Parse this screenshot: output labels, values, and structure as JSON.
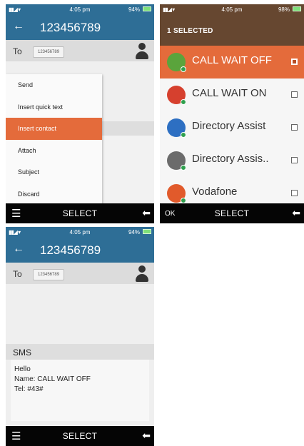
{
  "colors": {
    "title_bar": "#2e6e96",
    "selected_orange": "#e46b3b",
    "selection_header": "#664730",
    "softkey_bar": "#050505",
    "battery_green": "#7ee07a"
  },
  "screen1": {
    "status": {
      "time": "4:05 pm",
      "battery": "94%"
    },
    "title": {
      "back_icon": "arrow-left-icon",
      "number": "123456789"
    },
    "to_row": {
      "label": "To",
      "chip": "123456789",
      "icon": "person-icon"
    },
    "menu": {
      "items": [
        {
          "label": "Send",
          "selected": false
        },
        {
          "label": "Insert quick text",
          "selected": false
        },
        {
          "label": "Insert contact",
          "selected": true
        },
        {
          "label": "Attach",
          "selected": false
        },
        {
          "label": "Subject",
          "selected": false
        },
        {
          "label": "Discard",
          "selected": false
        }
      ]
    },
    "softkeys": {
      "left_icon": "menu-icon",
      "center": "SELECT",
      "right_icon": "back-arrow-icon"
    }
  },
  "screen2": {
    "status": {
      "time": "4:05 pm",
      "battery": "98%"
    },
    "header": "1 SELECTED",
    "contacts": [
      {
        "name": "CALL WAIT OFF",
        "selected": true,
        "checked": true,
        "avatar_color": "#5aa43c"
      },
      {
        "name": "CALL WAIT ON",
        "selected": false,
        "checked": false,
        "avatar_color": "#d6402e"
      },
      {
        "name": "Directory Assist",
        "selected": false,
        "checked": false,
        "avatar_color": "#2d6fc2"
      },
      {
        "name": "Directory Assis..",
        "selected": false,
        "checked": false,
        "avatar_color": "#6b6b6b"
      },
      {
        "name": "Vodafone",
        "selected": false,
        "checked": false,
        "avatar_color": "#e15a2b"
      }
    ],
    "softkeys": {
      "left": "OK",
      "center": "SELECT",
      "right_icon": "back-arrow-icon"
    }
  },
  "screen3": {
    "status": {
      "time": "4:05 pm",
      "battery": "94%"
    },
    "title": {
      "back_icon": "arrow-left-icon",
      "number": "123456789"
    },
    "to_row": {
      "label": "To",
      "chip": "123456789",
      "icon": "person-icon"
    },
    "sms": {
      "label": "SMS",
      "lines": [
        "Hello",
        "Name: CALL WAIT OFF",
        "Tel: #43#"
      ]
    },
    "softkeys": {
      "left_icon": "menu-icon",
      "center": "SELECT",
      "right_icon": "back-arrow-icon"
    }
  }
}
